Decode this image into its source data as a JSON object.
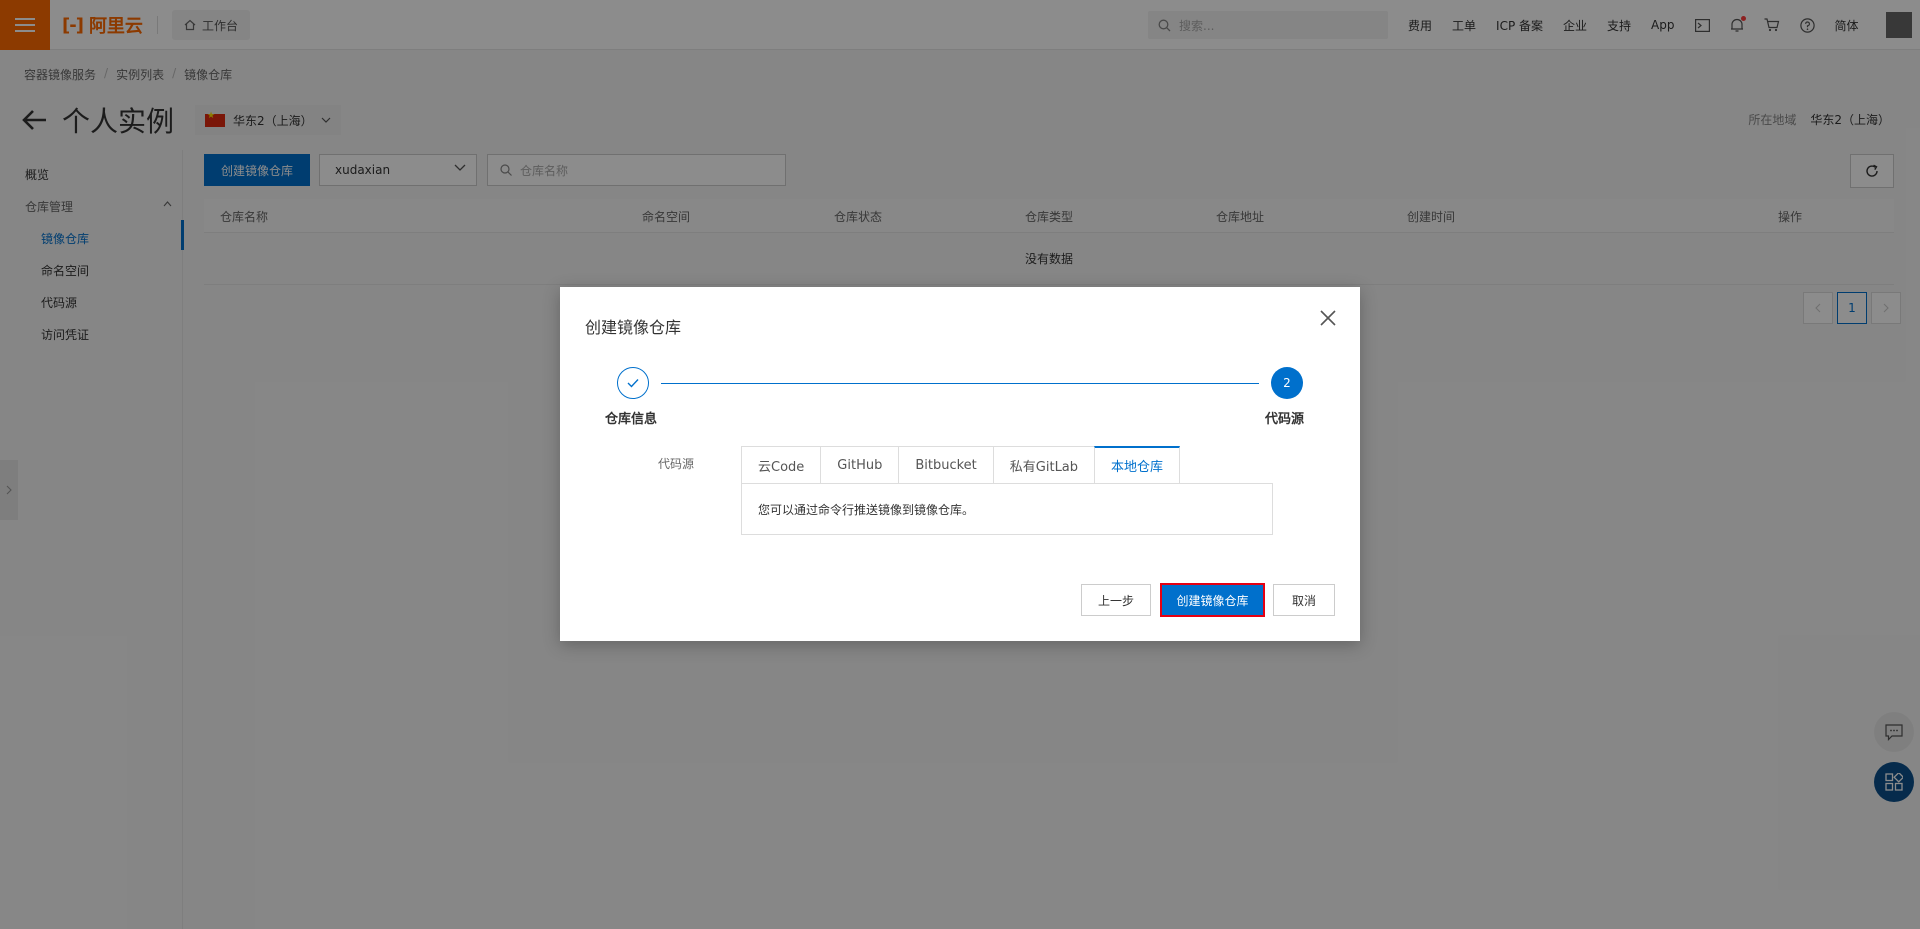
{
  "topbar": {
    "logo_text": "阿里云",
    "workbench": "工作台",
    "search_placeholder": "搜索...",
    "links": [
      "费用",
      "工单",
      "ICP 备案",
      "企业",
      "支持",
      "App"
    ],
    "language": "简体"
  },
  "breadcrumb": [
    "容器镜像服务",
    "实例列表",
    "镜像仓库"
  ],
  "page_title": "个人实例",
  "region": {
    "selected": "华东2（上海）",
    "info_label": "所在地域",
    "info_value": "华东2（上海）"
  },
  "sidebar": {
    "overview": "概览",
    "group": "仓库管理",
    "items": [
      "镜像仓库",
      "命名空间",
      "代码源",
      "访问凭证"
    ]
  },
  "toolbar": {
    "create_button": "创建镜像仓库",
    "namespace_value": "xudaxian",
    "search_placeholder": "仓库名称"
  },
  "table": {
    "columns": [
      "仓库名称",
      "命名空间",
      "仓库状态",
      "仓库类型",
      "仓库地址",
      "创建时间",
      "操作"
    ],
    "empty_text": "没有数据"
  },
  "pagination": {
    "current_page": "1"
  },
  "dialog": {
    "title": "创建镜像仓库",
    "steps": [
      "仓库信息",
      "代码源"
    ],
    "step2_number": "2",
    "field_label": "代码源",
    "tabs": [
      "云Code",
      "GitHub",
      "Bitbucket",
      "私有GitLab",
      "本地仓库"
    ],
    "active_tab": "本地仓库",
    "panel_text": "您可以通过命令行推送镜像到镜像仓库。",
    "buttons": {
      "prev": "上一步",
      "create": "创建镜像仓库",
      "cancel": "取消"
    }
  },
  "colors": {
    "brand_orange": "#ff6a00",
    "primary_blue": "#0070cc",
    "highlight_red": "#e60012"
  }
}
